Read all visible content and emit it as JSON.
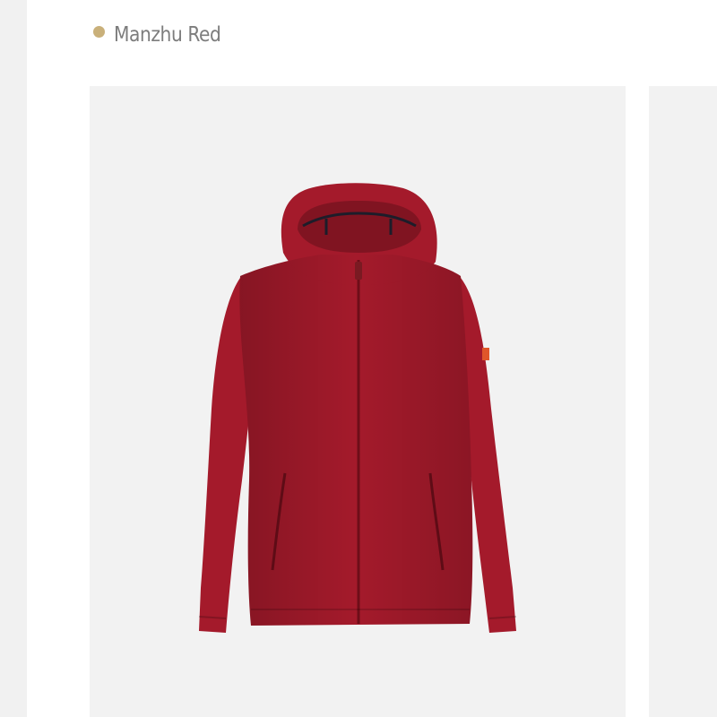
{
  "swatch": {
    "label": "Manzhu Red",
    "dot_color": "#c9b07a",
    "text_color": "#7d7d7d"
  },
  "product": {
    "image_icon": "red-hooded-jacket-image",
    "jacket_color": "#a41a2b",
    "background_color": "#f2f2f2"
  }
}
